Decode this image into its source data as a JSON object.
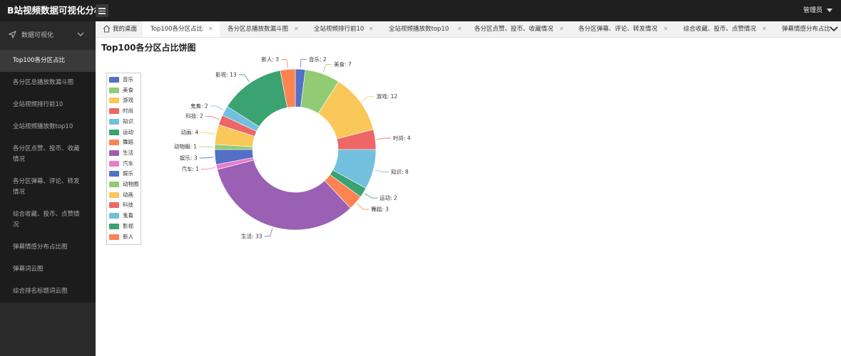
{
  "app": {
    "title": "B站视频数据可视化分析",
    "user": "管理员"
  },
  "sidebar": {
    "group": "数据可视化",
    "items": [
      {
        "label": "Top100各分区占比",
        "active": true
      },
      {
        "label": "各分区总播放数漏斗图"
      },
      {
        "label": "全站视频排行前10"
      },
      {
        "label": "全站视频播放数top10"
      },
      {
        "label": "各分区点赞、投币、收藏情况"
      },
      {
        "label": "各分区弹幕、评论、转发情况"
      },
      {
        "label": "综合收藏、投币、点赞情况"
      },
      {
        "label": "弹幕情感分布占比图"
      },
      {
        "label": "弹幕词云图"
      },
      {
        "label": "综合排名标题词云图"
      }
    ]
  },
  "tabs": [
    {
      "label": "我的桌面"
    },
    {
      "label": "Top100各分区占比",
      "active": true
    },
    {
      "label": "各分区总播放数漏斗图"
    },
    {
      "label": "全站视频排行前10"
    },
    {
      "label": "全站视频播放数top10"
    },
    {
      "label": "各分区点赞、投币、收藏情况"
    },
    {
      "label": "各分区弹幕、评论、转发情况"
    },
    {
      "label": "综合收藏、投币、点赞情况"
    },
    {
      "label": "弹幕情感分布占比图"
    }
  ],
  "chart_data": {
    "type": "pie",
    "title": "Top100各分区占比饼图",
    "donut": true,
    "legend_position": "left",
    "legend": [
      "音乐",
      "美食",
      "游戏",
      "时尚",
      "知识",
      "运动",
      "舞蹈",
      "生活",
      "汽车",
      "娱乐",
      "动物圈",
      "动画",
      "科技",
      "鬼畜",
      "影视",
      "新人"
    ],
    "slices": [
      {
        "name": "音乐",
        "value": 2,
        "color": "#5470c6"
      },
      {
        "name": "美食",
        "value": 7,
        "color": "#91cc75"
      },
      {
        "name": "游戏",
        "value": 12,
        "color": "#fac858"
      },
      {
        "name": "时尚",
        "value": 4,
        "color": "#ee6666"
      },
      {
        "name": "知识",
        "value": 8,
        "color": "#73c0de"
      },
      {
        "name": "运动",
        "value": 2,
        "color": "#3ba272"
      },
      {
        "name": "舞蹈",
        "value": 3,
        "color": "#fc8452"
      },
      {
        "name": "生活",
        "value": 33,
        "color": "#9a60b4"
      },
      {
        "name": "汽车",
        "value": 1,
        "color": "#ea7ccc"
      },
      {
        "name": "娱乐",
        "value": 3,
        "color": "#5470c6"
      },
      {
        "name": "动物圈",
        "value": 1,
        "color": "#91cc75"
      },
      {
        "name": "动画",
        "value": 4,
        "color": "#fac858"
      },
      {
        "name": "科技",
        "value": 2,
        "color": "#ee6666"
      },
      {
        "name": "鬼畜",
        "value": 2,
        "color": "#73c0de"
      },
      {
        "name": "影视",
        "value": 13,
        "color": "#3ba272"
      },
      {
        "name": "新人",
        "value": 3,
        "color": "#fc8452"
      }
    ]
  }
}
